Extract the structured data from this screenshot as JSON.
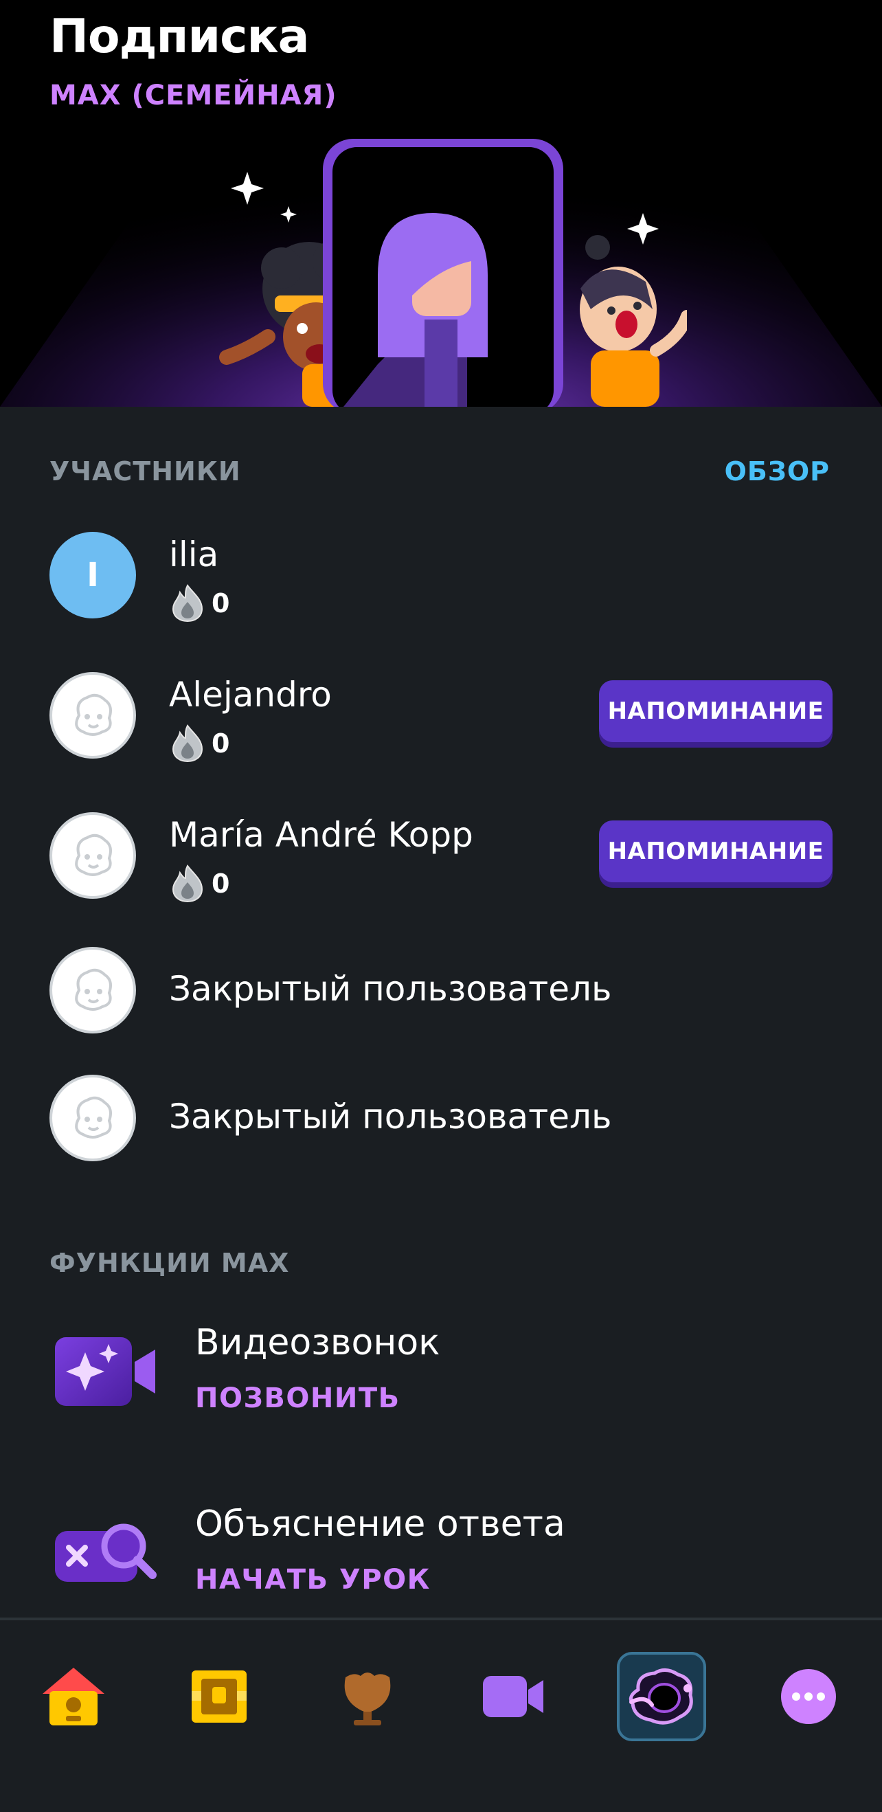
{
  "header": {
    "title": "Подписка",
    "plan": "MAX (СЕМЕЙНАЯ)"
  },
  "members_section": {
    "label": "УЧАСТНИКИ",
    "overview_link": "ОБЗОР",
    "members": [
      {
        "initial": "I",
        "name": "ilia",
        "streak": "0",
        "action": ""
      },
      {
        "initial": "",
        "name": "Alejandro",
        "streak": "0",
        "action": "НАПОМИНАНИЕ"
      },
      {
        "initial": "",
        "name": "María André Kopp",
        "streak": "0",
        "action": "НАПОМИНАНИЕ"
      },
      {
        "initial": "",
        "name": "Закрытый пользователь",
        "streak": "",
        "action": ""
      },
      {
        "initial": "",
        "name": "Закрытый пользователь",
        "streak": "",
        "action": ""
      }
    ]
  },
  "features_section": {
    "label": "ФУНКЦИИ MAX",
    "features": [
      {
        "icon": "video-call-icon",
        "title": "Видеозвонок",
        "action": "ПОЗВОНИТЬ"
      },
      {
        "icon": "explain-answer-icon",
        "title": "Объяснение ответа",
        "action": "НАЧАТЬ УРОК"
      }
    ]
  },
  "tabbar": {
    "tabs": [
      {
        "icon": "home-icon",
        "active": false
      },
      {
        "icon": "treasure-chest-icon",
        "active": false
      },
      {
        "icon": "league-trophy-icon",
        "active": false
      },
      {
        "icon": "video-call-icon",
        "active": false
      },
      {
        "icon": "max-icon",
        "active": true
      },
      {
        "icon": "more-icon",
        "active": false
      }
    ]
  },
  "colors": {
    "background": "#1a1e22",
    "max_purple": "#ce82ff",
    "link_blue": "#49c0f8",
    "button_purple": "#5a35c7",
    "avatar_blue": "#6ebdf2"
  }
}
